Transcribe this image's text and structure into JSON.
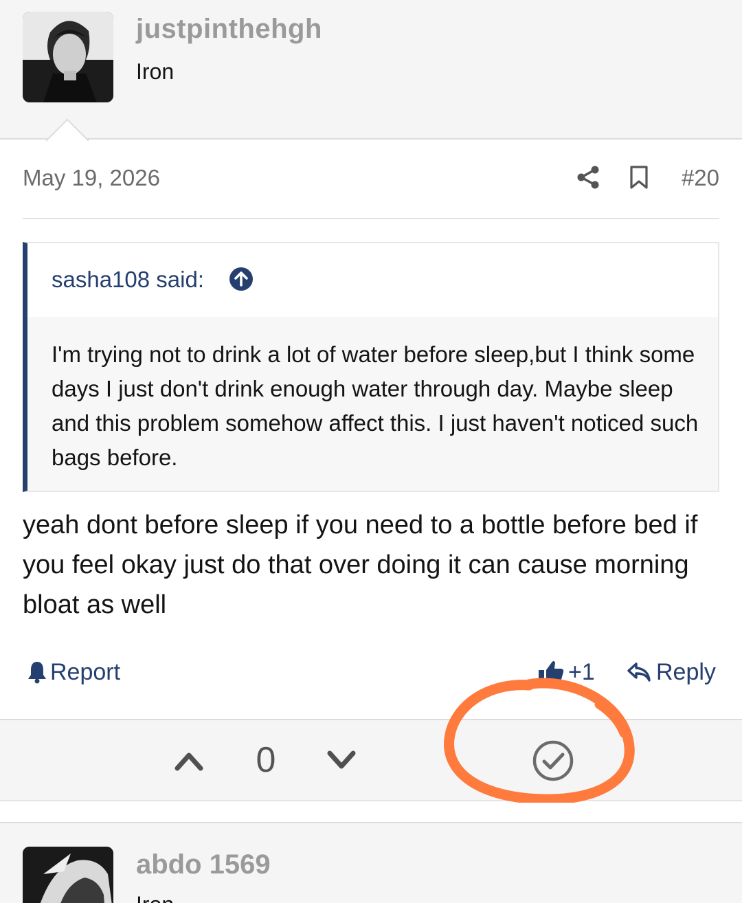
{
  "post": {
    "author": {
      "username": "justpinthehgh",
      "title": "Iron"
    },
    "date": "May 19, 2026",
    "number": "#20",
    "quote": {
      "author_label": "sasha108 said:",
      "text": "I'm trying not to drink a lot of water before sleep,but I think some days I just don't drink enough water through day. Maybe sleep and this problem somehow affect this. I just haven't noticed such bags before."
    },
    "body": "yeah dont before sleep if you need to a bottle before bed if you feel okay just do that over doing it can cause morning bloat as well",
    "actions": {
      "report": "Report",
      "like": "+1",
      "reply": "Reply"
    },
    "votes": {
      "count": "0"
    }
  },
  "next_post": {
    "author": {
      "username": "abdo 1569",
      "title": "Iron"
    }
  },
  "colors": {
    "link": "#253f6f",
    "annotation": "#ff7a3d",
    "muted": "#9a9a9a",
    "header_bg": "#f5f5f5"
  },
  "icons": [
    "share-icon",
    "bookmark-icon",
    "arrow-up-circle-icon",
    "bell-icon",
    "thumbs-up-icon",
    "reply-icon",
    "chevron-up-icon",
    "chevron-down-icon",
    "check-circle-icon"
  ]
}
